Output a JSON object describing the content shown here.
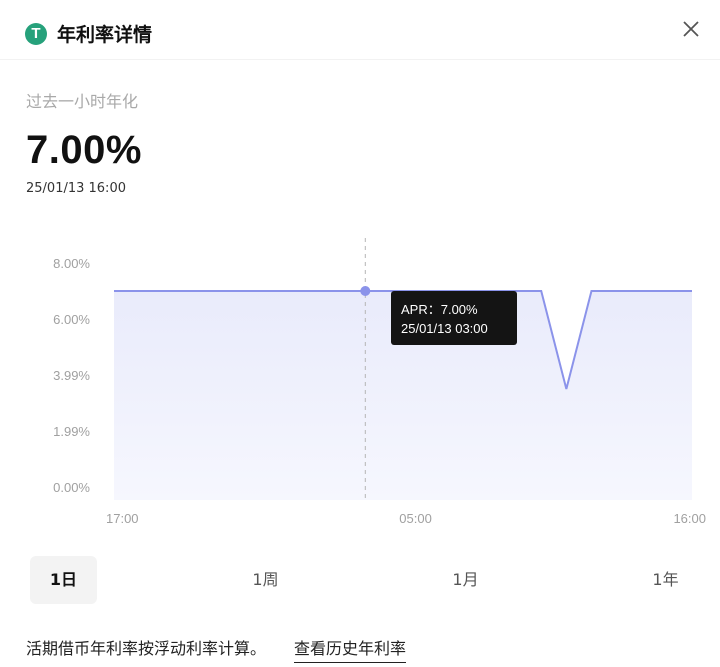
{
  "header": {
    "title": "年利率详情",
    "coin_glyph": "T",
    "coin_color": "#26a17b",
    "close_icon": "close-icon"
  },
  "summary": {
    "label": "过去一小时年化",
    "value": "7.00%",
    "timestamp": "25/01/13 16:00"
  },
  "tooltip": {
    "line1": "APR：7.00%",
    "line2": "25/01/13 03:00"
  },
  "ranges": [
    {
      "label": "1日",
      "active": true
    },
    {
      "label": "1周",
      "active": false
    },
    {
      "label": "1月",
      "active": false
    },
    {
      "label": "1年",
      "active": false
    }
  ],
  "footer": {
    "text": "活期借币年利率按浮动利率计算。",
    "link": "查看历史年利率"
  },
  "chart_data": {
    "type": "area",
    "x_tick_labels": [
      "17:00",
      "05:00",
      "16:00"
    ],
    "y_tick_labels": [
      "0.00%",
      "1.99%",
      "3.99%",
      "6.00%",
      "8.00%"
    ],
    "ylim": [
      0,
      8.0
    ],
    "x": [
      "17:00",
      "18:00",
      "19:00",
      "20:00",
      "21:00",
      "22:00",
      "23:00",
      "00:00",
      "01:00",
      "02:00",
      "03:00",
      "04:00",
      "05:00",
      "06:00",
      "07:00",
      "08:00",
      "09:00",
      "10:00",
      "11:00",
      "12:00",
      "13:00",
      "14:00",
      "15:00",
      "16:00"
    ],
    "series": [
      {
        "values": [
          7.0,
          7.0,
          7.0,
          7.0,
          7.0,
          7.0,
          7.0,
          7.0,
          7.0,
          7.0,
          7.0,
          7.0,
          7.0,
          7.0,
          7.0,
          7.0,
          7.0,
          7.0,
          3.5,
          7.0,
          7.0,
          7.0,
          7.0,
          7.0
        ]
      }
    ],
    "highlight_index": 10,
    "line_color": "#8b93ea",
    "fill_color": "#eef0fc",
    "grid": false
  }
}
